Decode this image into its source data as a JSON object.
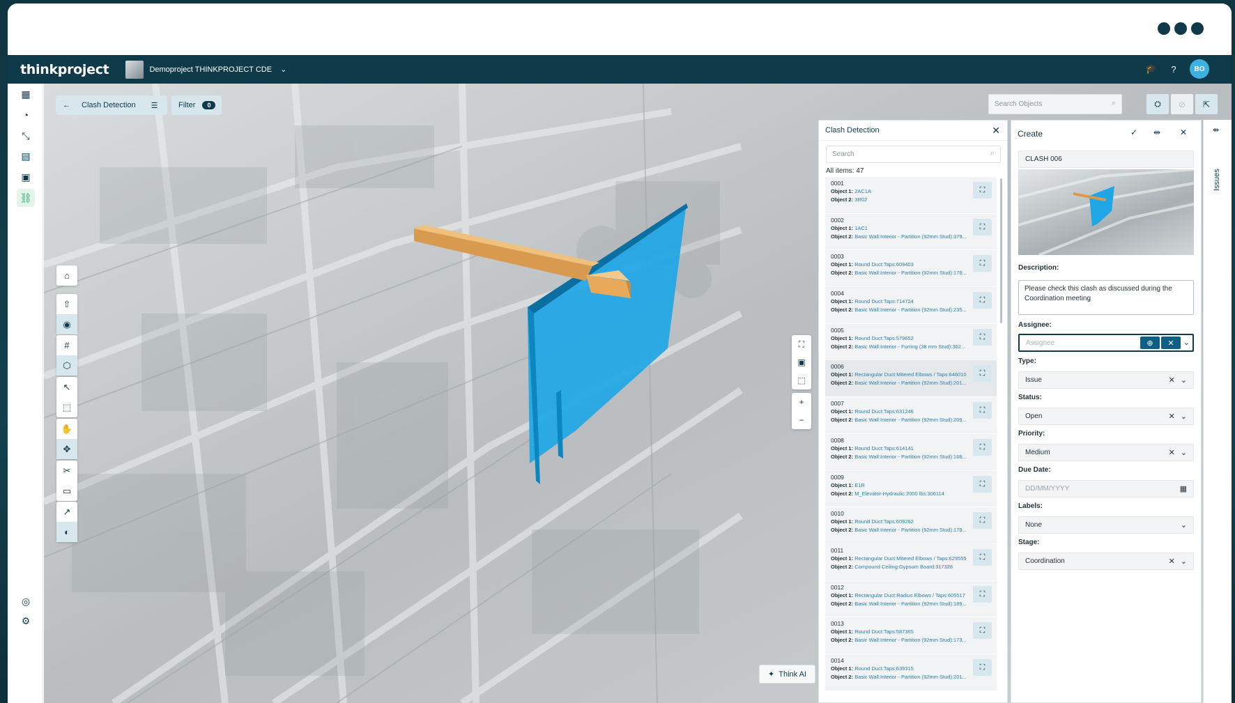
{
  "app": {
    "logo": "thinkproject",
    "project": "Demoproject THINKPROJECT CDE",
    "avatar": "BO"
  },
  "toolbar": {
    "clash_label": "Clash Detection",
    "filter_label": "Filter",
    "filter_count": "0",
    "search_placeholder": "Search Objects"
  },
  "think_ai": "Think AI",
  "clash_panel": {
    "title": "Clash Detection",
    "search_placeholder": "Search",
    "count_label": "All items: 47",
    "obj1_label": "Object 1:",
    "obj2_label": "Object 2:",
    "items": [
      {
        "id": "0001",
        "o1": "2AC1A",
        "o2": "3R02"
      },
      {
        "id": "0002",
        "o1": "1AC1",
        "o2": "Basic Wall:Interior - Partition (92mm Stud):379..."
      },
      {
        "id": "0003",
        "o1": "Round Duct:Taps:609403",
        "o2": "Basic Wall:Interior - Partition (92mm Stud):178..."
      },
      {
        "id": "0004",
        "o1": "Round Duct:Taps:714724",
        "o2": "Basic Wall:Interior - Partition (92mm Stud):235..."
      },
      {
        "id": "0005",
        "o1": "Round Duct:Taps:579652",
        "o2": "Basic Wall:Interior - Furring (38 mm Stud):362..."
      },
      {
        "id": "0006",
        "o1": "Rectangular Duct:Mitered Elbows / Taps:646010",
        "o2": "Basic Wall:Interior - Partition (92mm Stud):201..."
      },
      {
        "id": "0007",
        "o1": "Round Duct:Taps:631246",
        "o2": "Basic Wall:Interior - Partition (92mm Stud):209..."
      },
      {
        "id": "0008",
        "o1": "Round Duct:Taps:614141",
        "o2": "Basic Wall:Interior - Partition (92mm Stud):168..."
      },
      {
        "id": "0009",
        "o1": "E1R",
        "o2": "M_Elevator-Hydraulic:2000 lbs:306114"
      },
      {
        "id": "0010",
        "o1": "Round Duct:Taps:609262",
        "o2": "Basic Wall:Interior - Partition (92mm Stud):179..."
      },
      {
        "id": "0011",
        "o1": "Rectangular Duct:Mitered Elbows / Taps:629555",
        "o2": "Compound Ceiling:Gypsum Board:317328"
      },
      {
        "id": "0012",
        "o1": "Rectangular Duct:Radius Elbows / Taps:605517",
        "o2": "Basic Wall:Interior - Partition (92mm Stud):189..."
      },
      {
        "id": "0013",
        "o1": "Round Duct:Taps:587365",
        "o2": "Basic Wall:Interior - Partition (92mm Stud):173..."
      },
      {
        "id": "0014",
        "o1": "Round Duct:Taps:639315",
        "o2": "Basic Wall:Interior - Partition (92mm Stud):201..."
      }
    ]
  },
  "create_panel": {
    "title": "Create",
    "name": "CLASH 006",
    "description_label": "Description:",
    "description": "Please check this clash as discussed during the Coordination meeting",
    "assignee_label": "Assignee:",
    "assignee_placeholder": "Assignee",
    "type_label": "Type:",
    "type_value": "Issue",
    "status_label": "Status:",
    "status_value": "Open",
    "priority_label": "Priority:",
    "priority_value": "Medium",
    "due_label": "Due Date:",
    "due_placeholder": "DD/MM/YYYY",
    "labels_label": "Labels:",
    "labels_value": "None",
    "stage_label": "Stage:",
    "stage_value": "Coordination"
  },
  "issues_tab": "Issues",
  "colors": {
    "brand": "#0f3a4a",
    "accent": "#3fb1e0",
    "clash_wall": "#1fa6e6",
    "clash_duct": "#e8a95a"
  }
}
